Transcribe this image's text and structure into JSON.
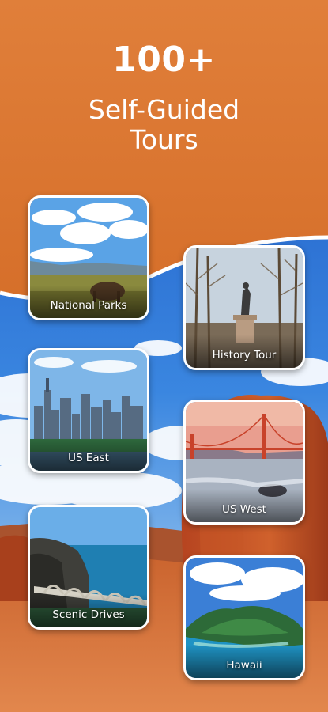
{
  "headline": {
    "count": "100+",
    "line1": "Self-Guided",
    "line2": "Tours"
  },
  "tours": [
    {
      "label": "National Parks",
      "icon": "national-parks-photo"
    },
    {
      "label": "History Tour",
      "icon": "history-tour-photo"
    },
    {
      "label": "US East",
      "icon": "us-east-photo"
    },
    {
      "label": "US West",
      "icon": "us-west-photo"
    },
    {
      "label": "Scenic Drives",
      "icon": "scenic-drives-photo"
    },
    {
      "label": "Hawaii",
      "icon": "hawaii-photo"
    }
  ],
  "colors": {
    "header": "#dc7a34",
    "sky": "#2b6fd1",
    "canyon": "#c2552a",
    "text": "#ffffff"
  }
}
